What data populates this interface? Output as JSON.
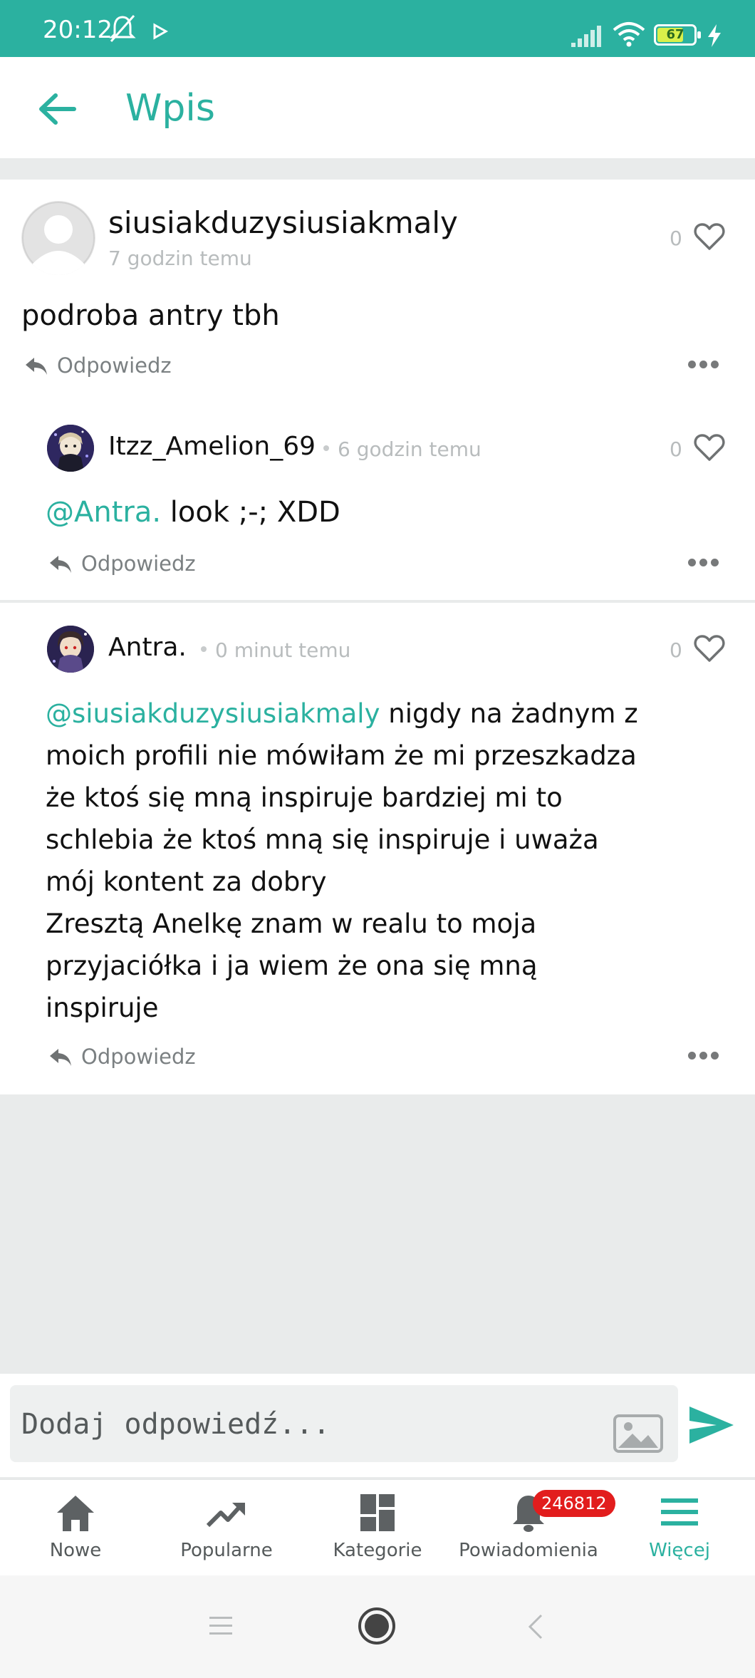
{
  "status_bar": {
    "time": "20:12",
    "battery_level": "67",
    "bg_color": "#2bb1a0"
  },
  "appbar": {
    "title": "Wpis",
    "back_icon": "arrow-left-icon"
  },
  "post": {
    "author": "siusiakduzysiusiakmaly",
    "time_ago": "7 godzin temu",
    "likes": "0",
    "text": "podroba antry tbh",
    "reply_label": "Odpowiedz"
  },
  "comments": [
    {
      "author": "Itzz_Amelion_69",
      "time_ago": "6 godzin temu",
      "likes": "0",
      "mention": "@Antra.",
      "text": " look ;-; XDD",
      "reply_label": "Odpowiedz"
    },
    {
      "author": "Antra.",
      "time_ago": "0 minut temu",
      "likes": "0",
      "mention": "@siusiakduzysiusiakmaly",
      "text_lines": [
        " nigdy na żadnym z",
        "moich profili nie mówiłam że mi przeszkadza",
        "że ktoś się mną inspiruje bardziej mi to",
        "schlebia że ktoś mną się inspiruje i uważa",
        "mój kontent za dobry",
        "Zresztą Anelkę znam w realu to moja",
        "przyjaciółka i ja wiem że ona się mną",
        "inspiruje"
      ],
      "reply_label": "Odpowiedz"
    }
  ],
  "composer": {
    "placeholder": "Dodaj odpowiedź..."
  },
  "bottom_nav": {
    "items": [
      {
        "label": "Nowe",
        "icon": "home-icon"
      },
      {
        "label": "Popularne",
        "icon": "trending-icon"
      },
      {
        "label": "Kategorie",
        "icon": "dashboard-icon"
      },
      {
        "label": "Powiadomienia",
        "icon": "bell-icon",
        "badge": "246812"
      },
      {
        "label": "Więcej",
        "icon": "menu-icon",
        "active": true
      }
    ]
  },
  "colors": {
    "accent": "#2bb1a0",
    "badge": "#e21d1d"
  }
}
